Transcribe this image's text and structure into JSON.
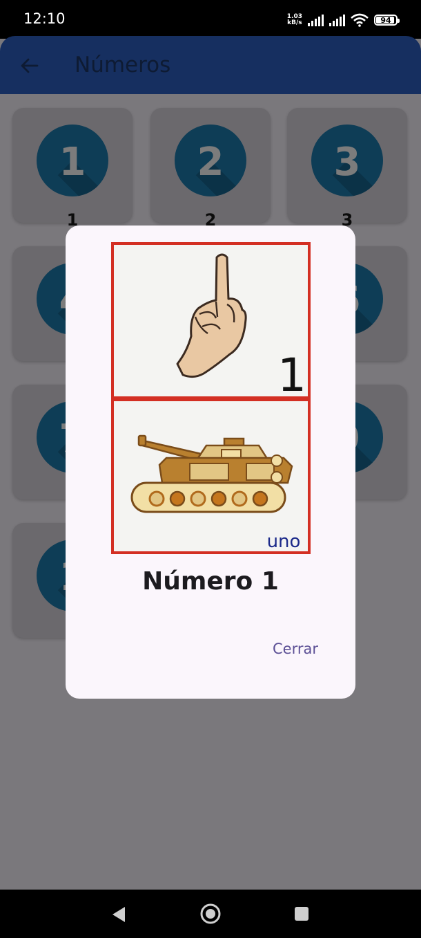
{
  "status_bar": {
    "time": "12:10",
    "net_speed_value": "1.03",
    "net_speed_unit": "kB/s",
    "battery": "94",
    "battery_level": 0.94,
    "icons": [
      "signal-icon",
      "signal-icon",
      "wifi-icon",
      "battery-icon"
    ]
  },
  "app_bar": {
    "title": "Números",
    "back_icon": "arrow-left-icon"
  },
  "grid": {
    "cards": [
      {
        "digit": "1",
        "label": "1"
      },
      {
        "digit": "2",
        "label": "2"
      },
      {
        "digit": "3",
        "label": "3"
      },
      {
        "digit": "4",
        "label": ""
      },
      {
        "digit": "",
        "label": ""
      },
      {
        "digit": "6",
        "label": ""
      },
      {
        "digit": "7",
        "label": ""
      },
      {
        "digit": "",
        "label": ""
      },
      {
        "digit": "9",
        "label": ""
      },
      {
        "digit": "1",
        "label": "1"
      }
    ]
  },
  "dialog": {
    "image_caption": "uno",
    "image_number": "1",
    "title": "Número 1",
    "close_label": "Cerrar"
  },
  "nav_bar": {
    "icons": [
      "back-triangle-icon",
      "home-circle-icon",
      "recents-square-icon"
    ]
  },
  "colors": {
    "app_bar": "#162f60",
    "scrim": "#7a787c",
    "dialog_bg": "#fbf6fc",
    "accent": "#5b4f95",
    "card_border": "#d32f23"
  }
}
